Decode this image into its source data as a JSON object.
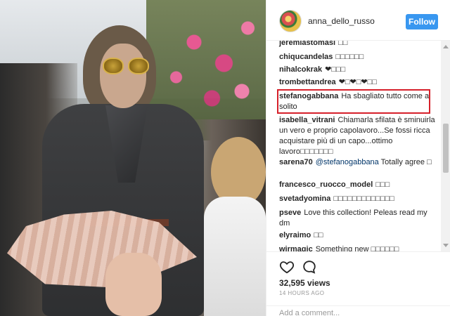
{
  "post": {
    "username": "anna_dello_russo",
    "follow_label": "Follow",
    "views": "32,595 views",
    "time": "14 HOURS AGO",
    "add_comment_placeholder": "Add a comment..."
  },
  "comments": [
    {
      "user": "jeremiastomasi",
      "text": "□□"
    },
    {
      "user": "chiqucandelas",
      "text": "□□□□□□"
    },
    {
      "user": "nihalcokrak",
      "text": "❤□□□"
    },
    {
      "user": "trombettandrea",
      "text": "❤□❤□❤□□"
    },
    {
      "user": "stefanogabbana",
      "text": "Ha sbagliato tutto come al solito"
    },
    {
      "user": "isabella_vitrani",
      "text": "Chiamarla sfilata è sminuirla un vero e proprio capolavoro...Se fossi ricca acquistare più di un capo...ottimo lavoro□□□□□□□"
    },
    {
      "user": "sarena70",
      "mention": "@stefanogabbana",
      "text": "Totally agree □"
    },
    {
      "user": "francesco_ruocco_model",
      "text": "□□□"
    },
    {
      "user": "svetadyomina",
      "text": "□□□□□□□□□□□□□"
    },
    {
      "user": "pseve",
      "text": "Love this collection! Peleas read my dm"
    },
    {
      "user": "elyraimo",
      "text": "□□"
    },
    {
      "user": "wirmagic",
      "text": "Something new □□□□□□"
    }
  ],
  "icons": {
    "like": "heart-icon",
    "comment": "comment-bubble-icon"
  },
  "colors": {
    "follow_button": "#3897f0",
    "highlight_border": "#d6202a"
  }
}
